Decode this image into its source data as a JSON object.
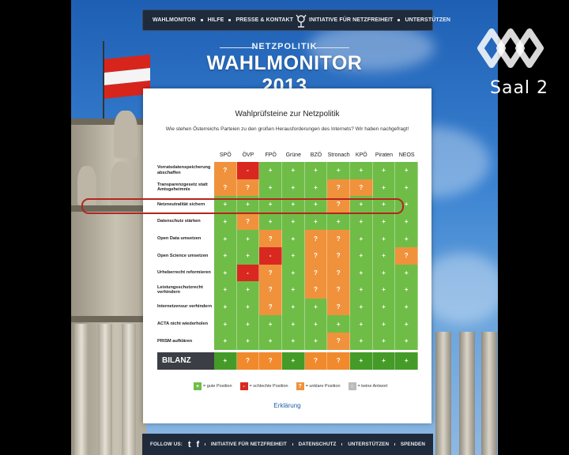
{
  "nav": {
    "items_left": [
      "WAHLMONITOR",
      "HILFE",
      "PRESSE & KONTAKT"
    ],
    "items_right": [
      "INITIATIVE FÜR NETZFREIHEIT",
      "UNTERSTÜTZEN"
    ]
  },
  "header": {
    "subtitle": "NETZPOLITIK",
    "title": "WAHLMONITOR 2013"
  },
  "panel": {
    "title": "Wahlprüfsteine zur Netzpolitik",
    "subtitle": "Wie stehen Österreichs Parteien zu den großen Herausforderungen des Internets? Wir haben nachgefragt!",
    "explain_link": "Erklärung"
  },
  "table": {
    "parties": [
      "SPÖ",
      "ÖVP",
      "FPÖ",
      "Grüne",
      "BZÖ",
      "Stronach",
      "KPÖ",
      "Piraten",
      "NEOS"
    ],
    "rows": [
      {
        "label": "Vorratsdatenspeicherung abschaffen",
        "cells": [
          "o",
          "r",
          "g",
          "g",
          "g",
          "g",
          "g",
          "g",
          "g"
        ]
      },
      {
        "label": "Transparenzgesetz statt Amtsgeheimnis",
        "cells": [
          "o",
          "o",
          "g",
          "g",
          "g",
          "o",
          "o",
          "g",
          "g"
        ]
      },
      {
        "label": "Netzneutralität sichern",
        "cells": [
          "g",
          "g",
          "g",
          "g",
          "g",
          "o",
          "g",
          "g",
          "g"
        ]
      },
      {
        "label": "Datenschutz stärken",
        "cells": [
          "g",
          "o",
          "g",
          "g",
          "g",
          "g",
          "g",
          "g",
          "g"
        ]
      },
      {
        "label": "Open Data umsetzen",
        "cells": [
          "g",
          "g",
          "o",
          "g",
          "o",
          "o",
          "g",
          "g",
          "g"
        ]
      },
      {
        "label": "Open Science umsetzen",
        "cells": [
          "g",
          "g",
          "r",
          "g",
          "o",
          "o",
          "g",
          "g",
          "o"
        ]
      },
      {
        "label": "Urheberrecht reformieren",
        "cells": [
          "g",
          "r",
          "o",
          "g",
          "o",
          "o",
          "g",
          "g",
          "g"
        ]
      },
      {
        "label": "Leistungsschutzrecht verhindern",
        "cells": [
          "g",
          "g",
          "o",
          "g",
          "o",
          "o",
          "g",
          "g",
          "g"
        ]
      },
      {
        "label": "Internetzensur verhindern",
        "cells": [
          "g",
          "g",
          "o",
          "g",
          "g",
          "o",
          "g",
          "g",
          "g"
        ]
      },
      {
        "label": "ACTA nicht wiederholen",
        "cells": [
          "g",
          "g",
          "g",
          "g",
          "g",
          "g",
          "g",
          "g",
          "g"
        ]
      },
      {
        "label": "PRISM aufklären",
        "cells": [
          "g",
          "g",
          "g",
          "g",
          "g",
          "o",
          "g",
          "g",
          "g"
        ]
      }
    ],
    "bilanz_label": "BILANZ",
    "bilanz": [
      "g",
      "o",
      "o",
      "g",
      "o",
      "o",
      "g",
      "g",
      "g"
    ],
    "symbols": {
      "g": "+",
      "r": "-",
      "o": "?"
    }
  },
  "legend": [
    {
      "key": "g",
      "symbol": "+",
      "text": "= gute Position",
      "color": "#6fbd47"
    },
    {
      "key": "r",
      "symbol": "-",
      "text": "= schlechte Position",
      "color": "#d9281f"
    },
    {
      "key": "o",
      "symbol": "?",
      "text": "= unklare Position",
      "color": "#f0923c"
    },
    {
      "key": "n",
      "symbol": "○",
      "text": "= keine Antwort",
      "color": "#bbbbbb"
    }
  ],
  "footer": {
    "follow": "FOLLOW US:",
    "twitter_glyph": "t",
    "facebook_glyph": "f",
    "items": [
      "INITIATIVE FÜR NETZFREIHEIT",
      "DATENSCHUTZ",
      "UNTERSTÜTZEN",
      "SPENDEN"
    ]
  },
  "overlay": {
    "channel": "Saal 2"
  }
}
